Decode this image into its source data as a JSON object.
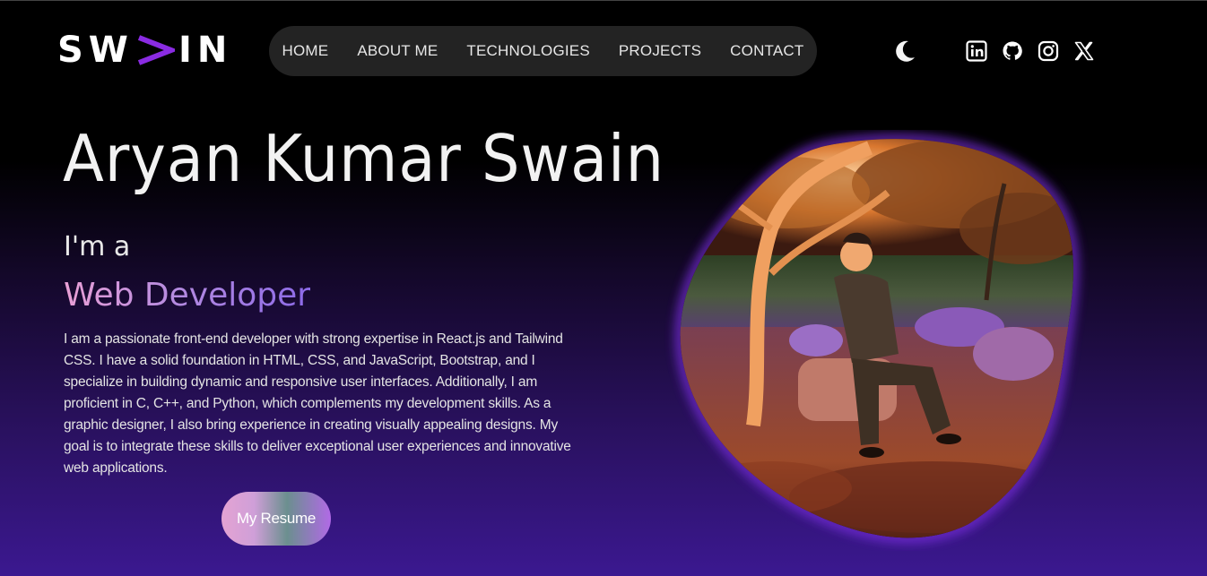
{
  "brand": {
    "logo_left": "SW",
    "logo_chevron": "⋗",
    "logo_right": "IN"
  },
  "nav": {
    "items": [
      "HOME",
      "ABOUT ME",
      "TECHNOLOGIES",
      "PROJECTS",
      "CONTACT"
    ]
  },
  "header_icons": {
    "theme_toggle": "moon-icon",
    "socials": [
      "linkedin-icon",
      "github-icon",
      "instagram-icon",
      "x-icon"
    ]
  },
  "hero": {
    "name": "Aryan Kumar Swain",
    "intro": "I'm a",
    "role": "Web Developer",
    "bio": "I am a passionate front-end developer with strong expertise in React.js and Tailwind CSS. I have a solid foundation in HTML, CSS, and JavaScript, Bootstrap, and I specialize in building dynamic and responsive user interfaces. Additionally, I am proficient in C, C++, and Python, which complements my development skills. As a graphic designer, I also bring experience in creating visually appealing designs. My goal is to integrate these skills to deliver exceptional user experiences and innovative web applications.",
    "resume_button": "My Resume"
  },
  "colors": {
    "accent_purple": "#8a2be2",
    "nav_bg": "#232323",
    "background_bottom": "#3b1890"
  }
}
